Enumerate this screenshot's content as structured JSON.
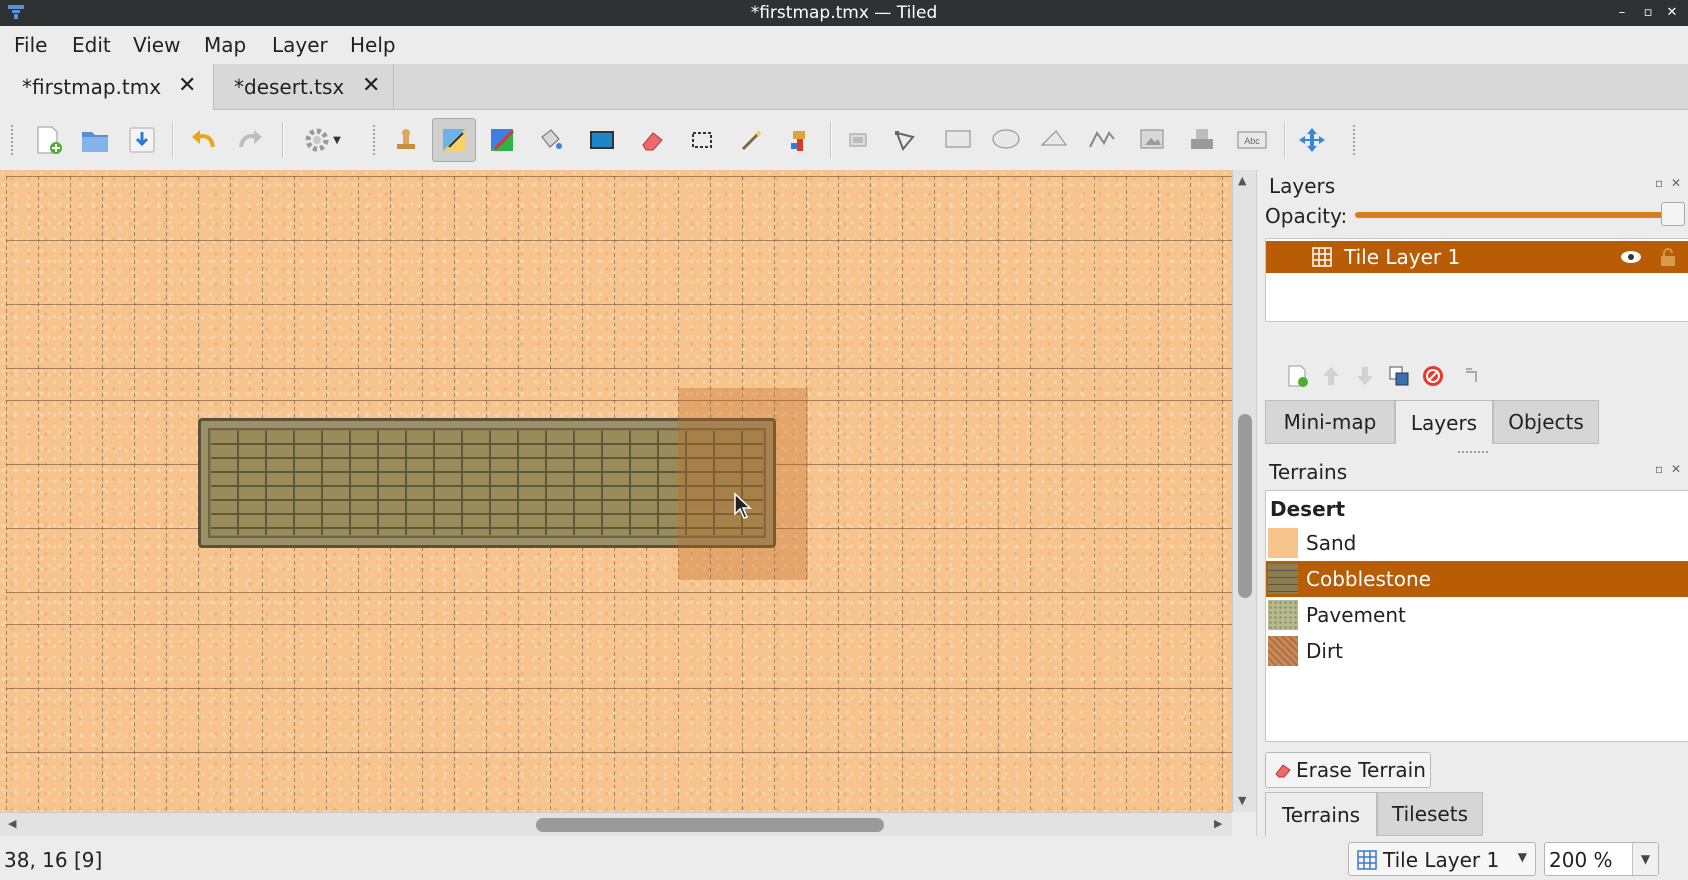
{
  "window": {
    "title": "*firstmap.tmx — Tiled",
    "controls": [
      "–",
      "▫",
      "✕"
    ]
  },
  "menu": [
    "File",
    "Edit",
    "View",
    "Map",
    "Layer",
    "Help"
  ],
  "tabs": [
    {
      "label": "*firstmap.tmx",
      "close": "✕",
      "active": true
    },
    {
      "label": "*desert.tsx",
      "close": "✕",
      "active": false
    }
  ],
  "toolbar": {
    "tools": [
      "new-map",
      "open",
      "save",
      "undo",
      "redo",
      "commands",
      "stamp-brush",
      "terrain-brush",
      "wang-brush",
      "bucket-fill",
      "shape-fill",
      "eraser",
      "rectangular-select",
      "magic-wand",
      "select-same-tile",
      "select-objects",
      "edit-polygons",
      "insert-rectangle",
      "insert-ellipse",
      "insert-polygon",
      "insert-polyline",
      "insert-tile",
      "insert-template",
      "insert-text",
      "offset-layers"
    ],
    "active_tool": "terrain-brush"
  },
  "canvas": {
    "sand_color": "#f7c48d",
    "cobble_color": "#8a7d52",
    "highlight_color": "#be6e28"
  },
  "status": {
    "coords": "38, 16 [9]",
    "layer_combo": "Tile Layer 1",
    "zoom": "200 %"
  },
  "layers_panel": {
    "title": "Layers",
    "opacity_label": "Opacity:",
    "opacity": 1.0,
    "layers": [
      {
        "name": "Tile Layer 1",
        "visible": true,
        "selected": true
      }
    ],
    "tabs": [
      "Mini-map",
      "Layers",
      "Objects"
    ],
    "active_tab": "Layers"
  },
  "terrains_panel": {
    "title": "Terrains",
    "tileset": "Desert",
    "terrains": [
      {
        "name": "Sand",
        "color": "#f7c48d",
        "selected": false
      },
      {
        "name": "Cobblestone",
        "color": "#8a7d52",
        "selected": true
      },
      {
        "name": "Pavement",
        "color": "#b7b98e",
        "selected": false
      },
      {
        "name": "Dirt",
        "color": "#c98a5a",
        "selected": false
      }
    ],
    "erase_label": "Erase Terrain",
    "tabs": [
      "Terrains",
      "Tilesets"
    ],
    "active_tab": "Terrains"
  },
  "colors": {
    "accent": "#b95c06",
    "slider": "#d77e1c",
    "titlebar": "#2f3233"
  }
}
